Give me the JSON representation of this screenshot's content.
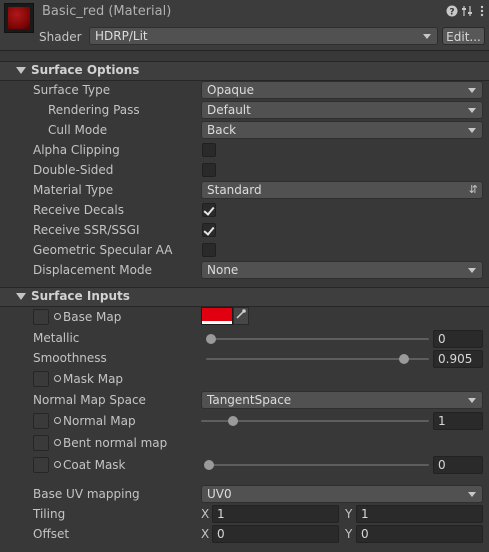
{
  "header": {
    "title": "Basic_red (Material)",
    "shader_label": "Shader",
    "shader_value": "HDRP/Lit",
    "edit_label": "Edit...",
    "icons": [
      "help-icon",
      "preset-icon",
      "more-options-icon"
    ],
    "thumbnail_color": "#8b0a0a"
  },
  "surface_options": {
    "title": "Surface Options",
    "surface_type": {
      "label": "Surface Type",
      "value": "Opaque"
    },
    "rendering_pass": {
      "label": "Rendering Pass",
      "value": "Default"
    },
    "cull_mode": {
      "label": "Cull Mode",
      "value": "Back"
    },
    "alpha_clipping": {
      "label": "Alpha Clipping",
      "checked": false
    },
    "double_sided": {
      "label": "Double-Sided",
      "checked": false
    },
    "material_type": {
      "label": "Material Type",
      "value": "Standard"
    },
    "receive_decals": {
      "label": "Receive Decals",
      "checked": true
    },
    "receive_ssr": {
      "label": "Receive SSR/SSGI",
      "checked": true
    },
    "geometric_specular_aa": {
      "label": "Geometric Specular AA",
      "checked": false
    },
    "displacement_mode": {
      "label": "Displacement Mode",
      "value": "None"
    }
  },
  "surface_inputs": {
    "title": "Surface Inputs",
    "base_map": {
      "label": "Base Map",
      "color": "#e0000f"
    },
    "metallic": {
      "label": "Metallic",
      "value": "0",
      "fraction": 0.0
    },
    "smoothness": {
      "label": "Smoothness",
      "value": "0.905",
      "fraction": 0.905
    },
    "mask_map": {
      "label": "Mask Map"
    },
    "normal_map_space": {
      "label": "Normal Map Space",
      "value": "TangentSpace"
    },
    "normal_map": {
      "label": "Normal Map",
      "value": "1",
      "fraction": 0.125
    },
    "bent_normal_map": {
      "label": "Bent normal map"
    },
    "coat_mask": {
      "label": "Coat Mask",
      "value": "0",
      "fraction": 0.0
    },
    "base_uv_mapping": {
      "label": "Base UV mapping",
      "value": "UV0"
    },
    "tiling": {
      "label": "Tiling",
      "x_label": "X",
      "x": "1",
      "y_label": "Y",
      "y": "1"
    },
    "offset": {
      "label": "Offset",
      "x_label": "X",
      "x": "0",
      "y_label": "Y",
      "y": "0"
    }
  }
}
